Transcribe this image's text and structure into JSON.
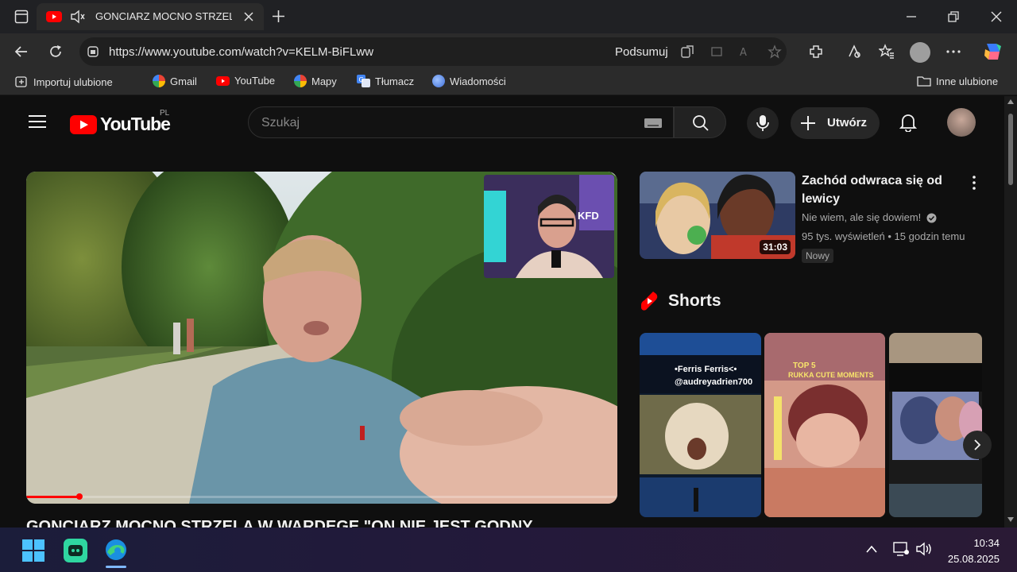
{
  "browser": {
    "tab_title": "GONCIARZ MOCNO STRZELA",
    "url": "https://www.youtube.com/watch?v=KELM-BiFLww",
    "summarize_label": "Podsumuj"
  },
  "favorites": {
    "import_label": "Importuj ulubione",
    "items": [
      {
        "label": "Gmail",
        "icon": "google-icon",
        "color": "#ea4335"
      },
      {
        "label": "YouTube",
        "icon": "youtube-icon",
        "color": "#ff0000"
      },
      {
        "label": "Mapy",
        "icon": "google-icon",
        "color": "#34a853"
      },
      {
        "label": "Tłumacz",
        "icon": "translate-icon",
        "color": "#4285f4"
      },
      {
        "label": "Wiadomości",
        "icon": "news-icon",
        "color": "#5b8def"
      }
    ],
    "other_label": "Inne ulubione"
  },
  "youtube": {
    "logo_text": "YouTube",
    "country_code": "PL",
    "search_placeholder": "Szukaj",
    "create_label": "Utwórz",
    "accent": "#ff0000",
    "video": {
      "title": "GONCIARZ MOCNO STRZELA W WARDEGE \"ON NIE JEST GODNY",
      "progress_fraction": 0.09,
      "overlay_label": "KFD"
    },
    "recommendation": {
      "title": "Zachód odwraca się od lewicy",
      "channel": "Nie wiem, ale się dowiem!",
      "meta": "95 tys. wyświetleń • 15 godzin temu",
      "badge": "Nowy",
      "duration": "31:03"
    },
    "shorts": {
      "heading": "Shorts",
      "items": [
        {
          "caption": "•Ferris Ferris<•",
          "subcaption": "@audreyadrien700"
        },
        {
          "caption": "TOP 5",
          "subcaption": "RUKKA CUTE MOMENTS"
        },
        {
          "caption": "",
          "subcaption": ""
        }
      ]
    }
  },
  "taskbar": {
    "time": "10:34",
    "date": "25.08.2025"
  }
}
